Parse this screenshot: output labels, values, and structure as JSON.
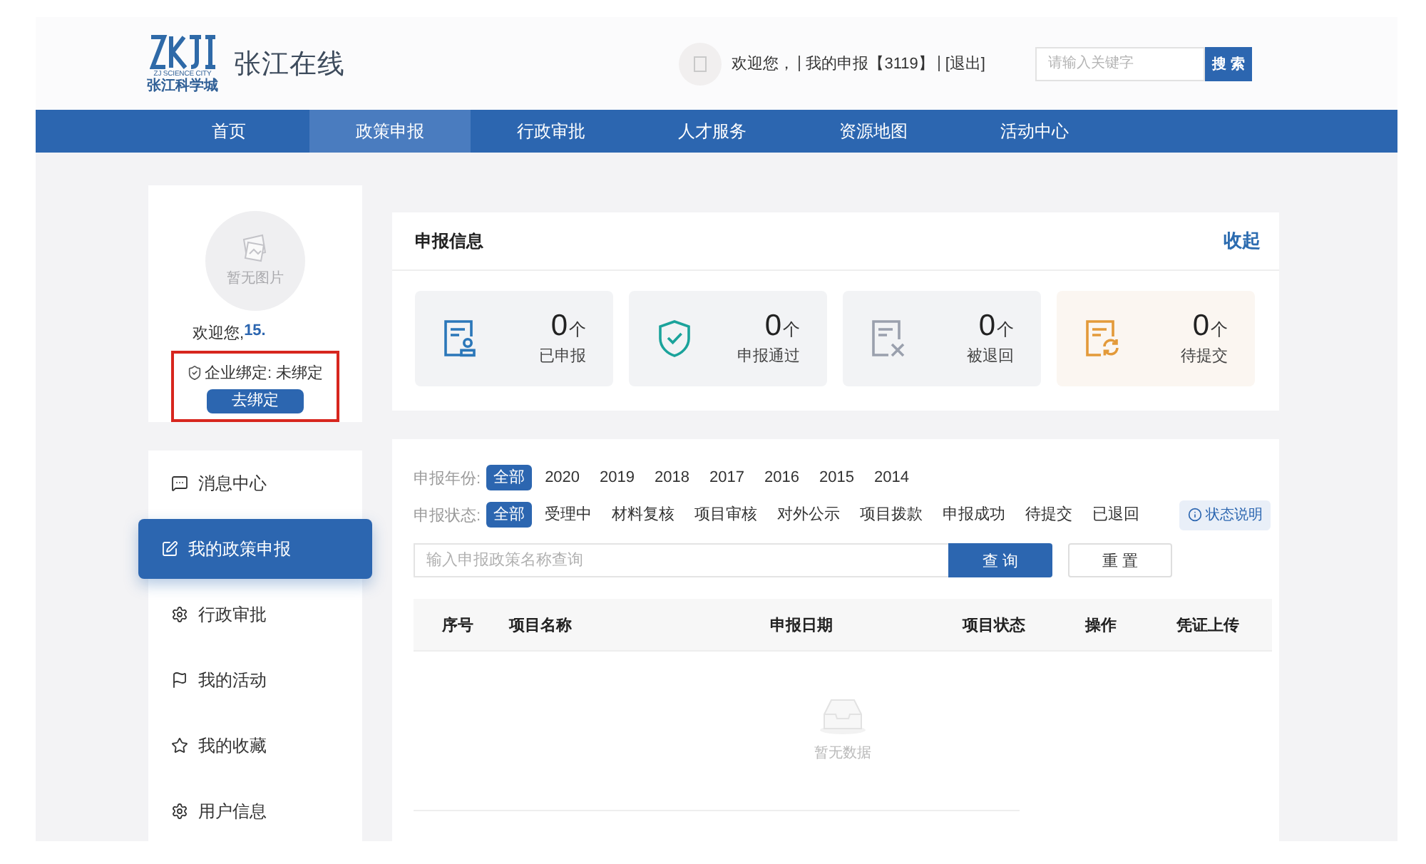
{
  "header": {
    "logo": {
      "tagline": "ZJ SCIENCE CITY",
      "name": "张江科学城"
    },
    "site_title": "张江在线",
    "user_bar": {
      "greeting": "欢迎您，",
      "links": [
        "我的申报【3119】",
        "[退出]"
      ]
    },
    "search": {
      "placeholder": "请输入关键字",
      "button": "搜 索"
    }
  },
  "nav": [
    {
      "label": "首页",
      "selected": false
    },
    {
      "label": "政策申报",
      "selected": true
    },
    {
      "label": "行政审批",
      "selected": false
    },
    {
      "label": "人才服务",
      "selected": false
    },
    {
      "label": "资源地图",
      "selected": false
    },
    {
      "label": "活动中心",
      "selected": false
    }
  ],
  "profile": {
    "avatar_caption": "暂无图片",
    "greeting": "欢迎您,",
    "username": "15.",
    "binding": {
      "status": "企业绑定: 未绑定",
      "button": "去绑定",
      "highlighted": true
    }
  },
  "menu": [
    {
      "label": "消息中心",
      "selected": false
    },
    {
      "label": "我的政策申报",
      "selected": true
    },
    {
      "label": "行政审批",
      "selected": false
    },
    {
      "label": "我的活动",
      "selected": false
    },
    {
      "label": "我的收藏",
      "selected": false
    },
    {
      "label": "用户信息",
      "selected": false
    }
  ],
  "summary": {
    "title": "申报信息",
    "toggle": "收起",
    "tiles": [
      {
        "kind": "submitted",
        "count": "0",
        "unit": "个",
        "label": "已申报"
      },
      {
        "kind": "approved",
        "count": "0",
        "unit": "个",
        "label": "申报通过"
      },
      {
        "kind": "returned",
        "count": "0",
        "unit": "个",
        "label": "被退回"
      },
      {
        "kind": "pending",
        "count": "0",
        "unit": "个",
        "label": "待提交"
      }
    ]
  },
  "filters": {
    "year": {
      "label": "申报年份:",
      "options": [
        {
          "label": "全部",
          "selected": true
        },
        {
          "label": "2020",
          "selected": false
        },
        {
          "label": "2019",
          "selected": false
        },
        {
          "label": "2018",
          "selected": false
        },
        {
          "label": "2017",
          "selected": false
        },
        {
          "label": "2016",
          "selected": false
        },
        {
          "label": "2015",
          "selected": false
        },
        {
          "label": "2014",
          "selected": false
        }
      ]
    },
    "status": {
      "label": "申报状态:",
      "options": [
        {
          "label": "全部",
          "selected": true
        },
        {
          "label": "受理中",
          "selected": false
        },
        {
          "label": "材料复核",
          "selected": false
        },
        {
          "label": "项目审核",
          "selected": false
        },
        {
          "label": "对外公示",
          "selected": false
        },
        {
          "label": "项目拨款",
          "selected": false
        },
        {
          "label": "申报成功",
          "selected": false
        },
        {
          "label": "待提交",
          "selected": false
        },
        {
          "label": "已退回",
          "selected": false
        }
      ]
    },
    "status_help": "状态说明"
  },
  "search": {
    "placeholder": "输入申报政策名称查询",
    "query_button": "查 询",
    "reset_button": "重 置"
  },
  "table": {
    "columns": [
      "序号",
      "项目名称",
      "申报日期",
      "项目状态",
      "操作",
      "凭证上传"
    ],
    "empty_text": "暂无数据"
  }
}
